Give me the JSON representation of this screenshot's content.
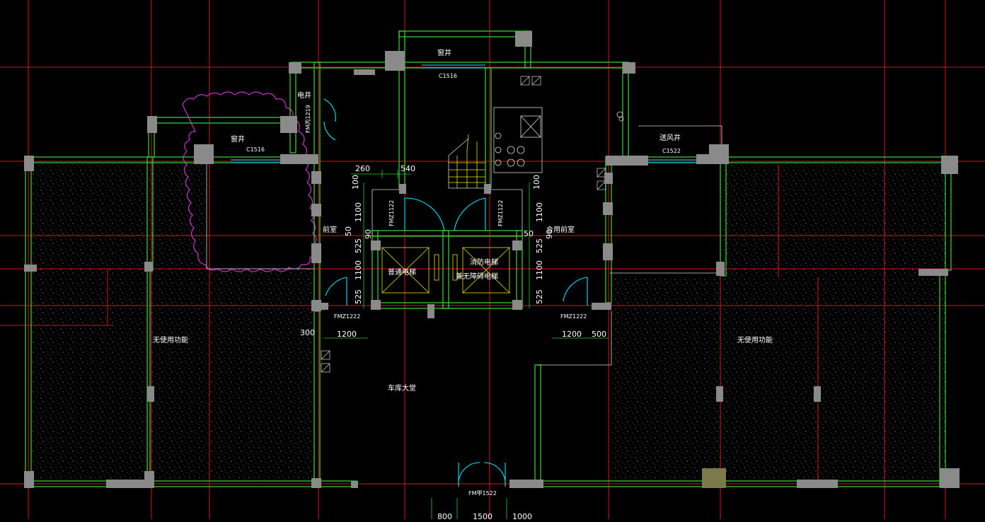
{
  "drawing": {
    "colors": {
      "background": "#000000",
      "grid": "#e01020",
      "wall": "#33cc33",
      "column": "#8a8a8a",
      "door": "#00e5ff",
      "cloud": "#cc33cc",
      "hatch": "#9a9a9a",
      "thin": "#ffffff",
      "yellow": "#e6e600"
    },
    "rooms": {
      "window_well_top": "窗井",
      "window_well_left": "窗井",
      "elec_shaft": "电井",
      "vestibule_left": "前室",
      "vestibule_shared": "合用前室",
      "air_shaft": "送风井",
      "elevator_normal": "普通电梯",
      "elevator_fire_line1": "消防电梯",
      "elevator_fire_line2": "兼无障碍电梯",
      "lobby": "车库大堂",
      "undefined_left": "无使用功能",
      "undefined_right": "无使用功能"
    },
    "doors": {
      "c1516_top": "C1516",
      "c1516_left": "C1516",
      "c1522": "C1522",
      "fm_elec": "FM丙1219",
      "fmz_left": "FMZ1122",
      "fmz_right": "FMZ1122",
      "fmz_low_left": "FMZ1222",
      "fmz_low_right": "FMZ1222",
      "fm_main": "FM甲1522"
    },
    "dimensions": {
      "d260": "260",
      "d540": "540",
      "d100_l": "100",
      "d1100_l1": "1100",
      "d50_l": "50",
      "d90_l": "90",
      "d525_l1": "525",
      "d1100_l2": "1100",
      "d525_l2": "525",
      "d100_r": "100",
      "d1100_r1": "1100",
      "d50_r": "50",
      "d90_r": "90",
      "d525_r1": "525",
      "d1100_r2": "1100",
      "d525_r2": "525",
      "d300": "300",
      "d1200_l": "1200",
      "d1200_r": "1200",
      "d500": "500",
      "d800": "800",
      "d1500": "1500",
      "d1000": "1000"
    }
  }
}
